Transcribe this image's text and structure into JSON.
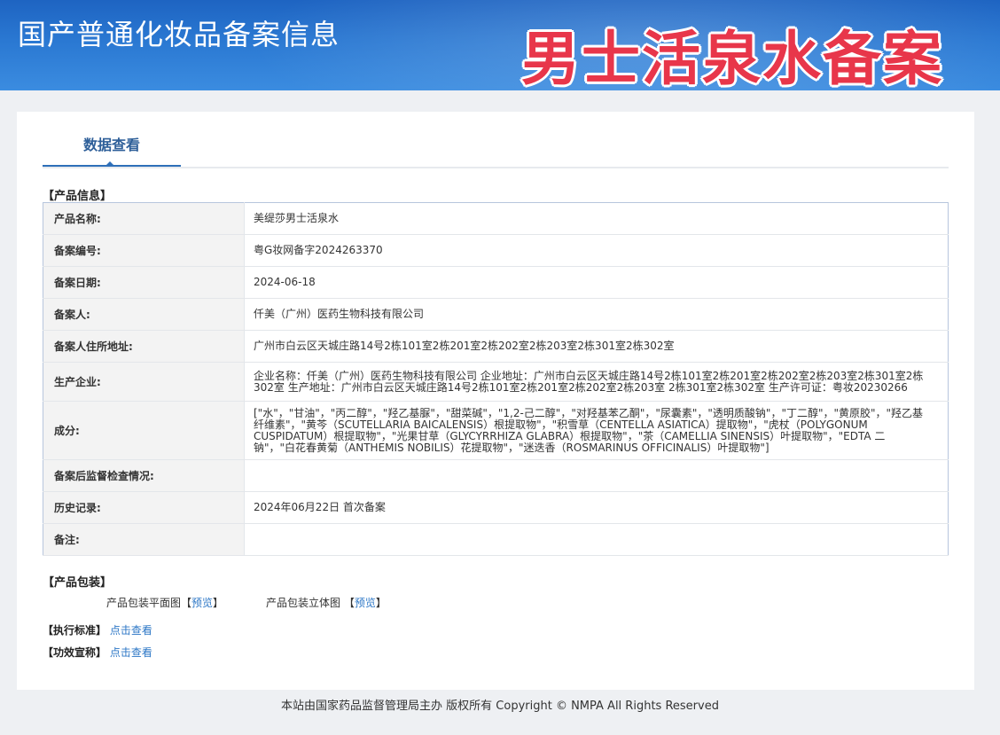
{
  "header": {
    "site_title": "国产普通化妆品备案信息",
    "overlay_title": "男士活泉水备案"
  },
  "tabs": [
    {
      "label": "数据查看"
    }
  ],
  "product_info": {
    "section_title": "【产品信息】",
    "rows": [
      {
        "label": "产品名称:",
        "value": "美缇莎男士活泉水"
      },
      {
        "label": "备案编号:",
        "value": "粤G妆网备字2024263370"
      },
      {
        "label": "备案日期:",
        "value": "2024-06-18"
      },
      {
        "label": "备案人:",
        "value": "仟美（广州）医药生物科技有限公司"
      },
      {
        "label": "备案人住所地址:",
        "value": "广州市白云区天城庄路14号2栋101室2栋201室2栋202室2栋203室2栋301室2栋302室"
      },
      {
        "label": "生产企业:",
        "value": "企业名称：仟美（广州）医药生物科技有限公司 企业地址：广州市白云区天城庄路14号2栋101室2栋201室2栋202室2栋203室2栋301室2栋302室 生产地址：广州市白云区天城庄路14号2栋101室2栋201室2栋202室2栋203室 2栋301室2栋302室 生产许可证：粤妆20230266"
      },
      {
        "label": "成分:",
        "value": "[\"水\"，\"甘油\"，\"丙二醇\"，\"羟乙基脲\"，\"甜菜碱\"，\"1,2-己二醇\"，\"对羟基苯乙酮\"，\"尿囊素\"，\"透明质酸钠\"，\"丁二醇\"，\"黄原胶\"，\"羟乙基纤维素\"，\"黄芩（SCUTELLARIA BAICALENSIS）根提取物\"，\"积雪草（CENTELLA ASIATICA）提取物\"，\"虎杖（POLYGONUM CUSPIDATUM）根提取物\"，\"光果甘草（GLYCYRRHIZA GLABRA）根提取物\"，\"茶（CAMELLIA SINENSIS）叶提取物\"，\"EDTA 二钠\"，\"白花春黄菊（ANTHEMIS NOBILIS）花提取物\"，\"迷迭香（ROSMARINUS OFFICINALIS）叶提取物\"]"
      },
      {
        "label": "备案后监督检查情况:",
        "value": ""
      },
      {
        "label": "历史记录:",
        "value": "2024年06月22日 首次备案"
      },
      {
        "label": "备注:",
        "value": ""
      }
    ]
  },
  "packaging": {
    "section_title": "【产品包装】",
    "flat_label": "产品包装平面图",
    "solid_label": "产品包装立体图",
    "bracket_open": "【",
    "bracket_close": "】",
    "preview_link": "预览"
  },
  "standard": {
    "title": "【执行标准】",
    "link": "点击查看"
  },
  "efficacy": {
    "title": "【功效宣称】",
    "link": "点击查看"
  },
  "footer": {
    "text": "本站由国家药品监督管理局主办 版权所有 Copyright © NMPA All Rights Reserved"
  }
}
